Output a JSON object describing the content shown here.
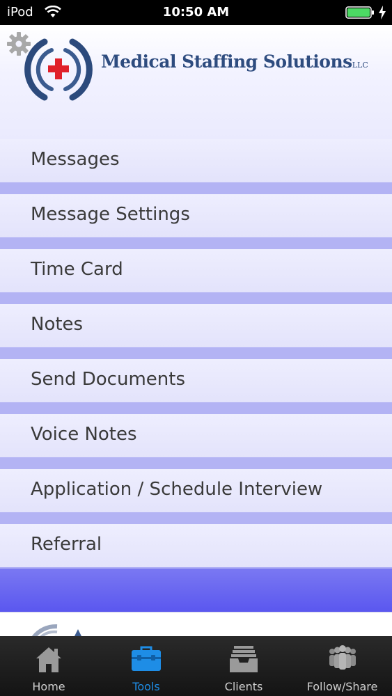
{
  "status_bar": {
    "carrier": "iPod",
    "time": "10:50 AM"
  },
  "header": {
    "company_name": "Medical Staffing Solutions",
    "company_suffix": "LLC"
  },
  "menu": {
    "items": [
      {
        "label": "Messages"
      },
      {
        "label": "Message Settings"
      },
      {
        "label": "Time Card"
      },
      {
        "label": "Notes"
      },
      {
        "label": "Send Documents"
      },
      {
        "label": "Voice Notes"
      },
      {
        "label": "Application / Schedule Interview"
      },
      {
        "label": "Referral"
      }
    ]
  },
  "tab_bar": {
    "tabs": [
      {
        "label": "Home",
        "icon": "home-icon"
      },
      {
        "label": "Tools",
        "icon": "toolbox-icon",
        "active": true
      },
      {
        "label": "Clients",
        "icon": "inbox-tray-icon"
      },
      {
        "label": "Follow/Share",
        "icon": "people-group-icon"
      }
    ]
  },
  "colors": {
    "accent": "#1e8de6",
    "brand": "#2e4c7f",
    "logo_red": "#e0202a",
    "battery": "#4cd964"
  }
}
